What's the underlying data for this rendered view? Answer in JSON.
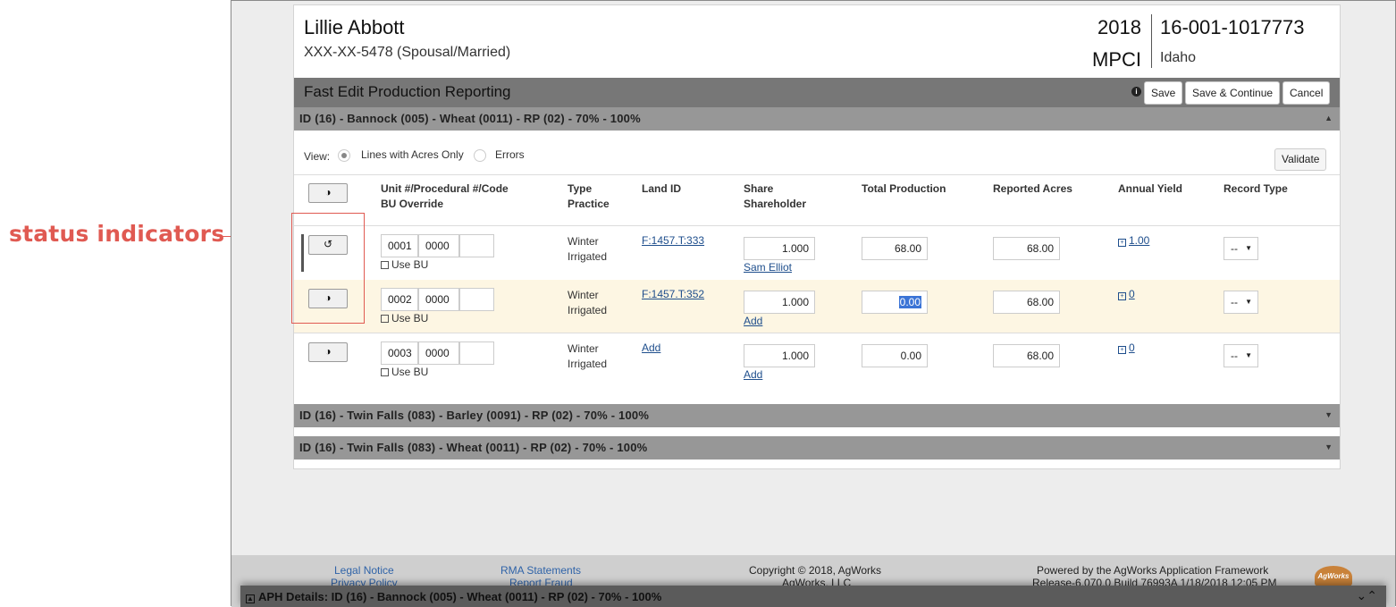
{
  "annotation": {
    "label": "status indicators",
    "color": "#e05a52"
  },
  "header": {
    "name": "Lillie Abbott",
    "ssn": "XXX-XX-5478 (Spousal/Married)",
    "year": "2018",
    "program": "MPCI",
    "policy": "16-001-1017773",
    "state": "Idaho"
  },
  "toolbar": {
    "title": "Fast Edit Production Reporting",
    "save": "Save",
    "save_continue": "Save & Continue",
    "cancel": "Cancel"
  },
  "sections": [
    {
      "title": "ID (16) - Bannock (005) - Wheat (0011) - RP (02) - 70% - 100%",
      "expanded": true
    },
    {
      "title": "ID (16) - Twin Falls (083) - Barley (0091) - RP (02) - 70% - 100%",
      "expanded": false
    },
    {
      "title": "ID (16) - Twin Falls (083) - Wheat (0011) - RP (02) - 70% - 100%",
      "expanded": false
    }
  ],
  "view": {
    "label": "View:",
    "options": [
      "Lines with Acres Only",
      "Errors"
    ],
    "selected": "Lines with Acres Only",
    "validate": "Validate"
  },
  "columns": {
    "unit": [
      "Unit #/Procedural #/Code",
      "BU Override"
    ],
    "type": [
      "Type",
      "Practice"
    ],
    "land": "Land ID",
    "share": [
      "Share",
      "Shareholder"
    ],
    "production": "Total Production",
    "acres": "Reported Acres",
    "yield": "Annual Yield",
    "record": "Record Type"
  },
  "rows": [
    {
      "unit": "0001",
      "proc": "0000",
      "code": "",
      "use_bu": "Use BU",
      "type": "Winter",
      "practice": "Irrigated",
      "land": "F:1457.T:333",
      "share": "1.000",
      "shareholder": "Sam Elliot",
      "production": "68.00",
      "acres": "68.00",
      "yield": "1.00",
      "record": "--",
      "status": "reset"
    },
    {
      "unit": "0002",
      "proc": "0000",
      "code": "",
      "use_bu": "Use BU",
      "type": "Winter",
      "practice": "Irrigated",
      "land": "F:1457.T:352",
      "share": "1.000",
      "shareholder": "Add",
      "production": "0.00",
      "acres": "68.00",
      "yield": "0",
      "record": "--",
      "status": "half"
    },
    {
      "unit": "0003",
      "proc": "0000",
      "code": "",
      "use_bu": "Use BU",
      "type": "Winter",
      "practice": "Irrigated",
      "land": "Add",
      "share": "1.000",
      "shareholder": "Add",
      "production": "0.00",
      "acres": "68.00",
      "yield": "0",
      "record": "--",
      "status": "half"
    }
  ],
  "footer": {
    "legal": "Legal Notice",
    "privacy": "Privacy Policy",
    "rma": "RMA Statements",
    "fraud": "Report Fraud",
    "copyright": "Copyright © 2018, AgWorks",
    "company": "AgWorks, LLC",
    "powered": "Powered by the AgWorks Application Framework",
    "release": "Release-6.070.0 Build 76993A 1/18/2018 12:05 PM",
    "logo": "AgWorks"
  },
  "aph": {
    "title": "APH Details: ID (16) - Bannock (005) - Wheat (0011) - RP (02) - 70% - 100%"
  }
}
